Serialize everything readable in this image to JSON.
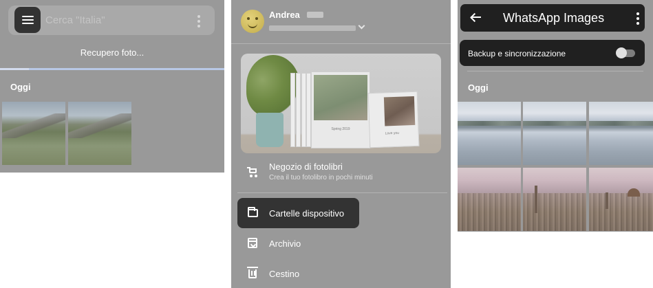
{
  "panel_photos": {
    "search_placeholder": "Cerca \"Italia\"",
    "status_text": "Recupero foto...",
    "progress_fraction": 0.13,
    "section_label": "Oggi",
    "thumbnails": [
      "mountain-photo",
      "mountain-photo"
    ]
  },
  "panel_drawer": {
    "account_name": "Andrea",
    "banner_book_caption": "Spring 2019",
    "banner_card_caption": "Love you",
    "items": [
      {
        "label": "Negozio di fotolibri",
        "subtitle": "Crea il tuo fotolibro in pochi minuti",
        "icon": "cart-icon"
      },
      {
        "label": "Cartelle dispositivo",
        "icon": "folder-icon",
        "active": true
      },
      {
        "label": "Archivio",
        "icon": "archive-icon"
      },
      {
        "label": "Cestino",
        "icon": "trash-icon"
      }
    ]
  },
  "panel_album": {
    "title": "WhatsApp Images",
    "backup_label": "Backup e sincronizzazione",
    "backup_enabled": false,
    "section_label": "Oggi",
    "thumbnails": [
      "lake-photo",
      "lake-photo",
      "lake-photo",
      "florence-photo",
      "florence-photo",
      "florence-photo"
    ]
  },
  "colors": {
    "overlay_gray": "#999999",
    "dark_highlight": "#202020",
    "active_pill": "#333333",
    "text": "#ffffff"
  }
}
